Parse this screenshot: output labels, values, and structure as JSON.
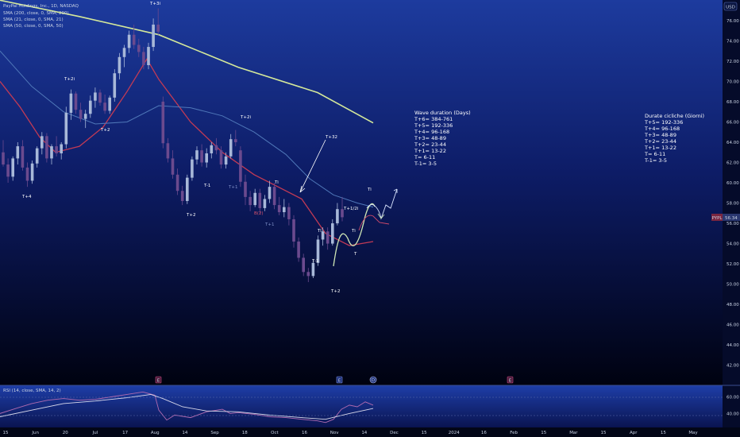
{
  "symbol_box": {
    "label": "USD"
  },
  "legend": [
    "PayPal Holdings, Inc., 1D, NASDAQ",
    "SMA (200, close, 0, SMA, 200)",
    "SMA (21, close, 0, SMA, 21)",
    "SMA (50, close, 0, SMA, 50)"
  ],
  "price_badge": {
    "ticker": "PYPL",
    "price": "56.34"
  },
  "rsi_legend": "RSI (14, close, SMA, 14, 2)",
  "notes": {
    "english": {
      "title": "Wave duration (Days)",
      "lines": [
        "T+6= 384-761",
        "T+5= 192-336",
        "T+4= 96-168",
        "T+3= 48-89",
        "T+2= 23-44",
        "T+1= 13-22",
        "T= 6-11",
        "T-1= 3-5"
      ]
    },
    "italian": {
      "title": "Durate cicliche (Giorni)",
      "lines": [
        "T+5= 192-336",
        "T+4= 96-168",
        "T+3= 48-89",
        "T+2= 23-44",
        "T+1= 13-22",
        "T= 6-11",
        "T-1= 3-5"
      ]
    }
  },
  "wave_labels": [
    {
      "text": "T+3i",
      "style": "white"
    },
    {
      "text": "T+2i",
      "style": "white"
    },
    {
      "text": "T+2",
      "style": "white"
    },
    {
      "text": "T+4",
      "style": "white"
    },
    {
      "text": "T+2",
      "style": "white"
    },
    {
      "text": "T-1",
      "style": "white"
    },
    {
      "text": "T+1",
      "style": "blue"
    },
    {
      "text": "T+2i",
      "style": "white"
    },
    {
      "text": "Ti",
      "style": "white"
    },
    {
      "text": "T+1",
      "style": "blue"
    },
    {
      "text": "B(2)",
      "style": "red"
    },
    {
      "text": "T+32",
      "style": "white"
    },
    {
      "text": "Ti",
      "style": "white"
    },
    {
      "text": "T-1",
      "style": "white"
    },
    {
      "text": "T+2",
      "style": "white"
    },
    {
      "text": "T+1/2i",
      "style": "white"
    },
    {
      "text": "Ti",
      "style": "white"
    },
    {
      "text": "T",
      "style": "white"
    },
    {
      "text": "Ti",
      "style": "white"
    }
  ],
  "event_markers": [
    "E",
    "E",
    "D",
    "E"
  ],
  "chart_data": [
    {
      "type": "line",
      "title": "PayPal Holdings, Inc., 1D, NASDAQ",
      "x_ticks": [
        "15",
        "Jun",
        "20",
        "Jul",
        "17",
        "Aug",
        "14",
        "Sep",
        "18",
        "Oct",
        "16",
        "Nov",
        "14",
        "Dec",
        "15",
        "2024",
        "16",
        "Feb",
        "15",
        "Mar",
        "15",
        "Apr",
        "15",
        "May"
      ],
      "y_ticks": [
        76.0,
        74.0,
        72.0,
        70.0,
        68.0,
        66.0,
        64.0,
        62.0,
        60.0,
        58.0,
        56.0,
        54.0,
        52.0,
        50.0,
        48.0,
        46.0,
        44.0,
        42.0
      ],
      "ylim": [
        40.8,
        77.4
      ],
      "candles": [
        [
          63.0,
          64.2,
          61.6,
          61.8
        ],
        [
          61.8,
          62.4,
          60.0,
          60.6
        ],
        [
          60.6,
          62.6,
          60.2,
          62.4
        ],
        [
          62.4,
          64.0,
          61.8,
          63.6
        ],
        [
          63.6,
          64.2,
          61.2,
          61.5
        ],
        [
          61.5,
          62.0,
          59.6,
          60.2
        ],
        [
          60.2,
          62.2,
          59.9,
          61.9
        ],
        [
          61.9,
          63.6,
          61.5,
          63.4
        ],
        [
          63.4,
          65.0,
          62.8,
          64.6
        ],
        [
          64.6,
          64.9,
          62.0,
          62.4
        ],
        [
          62.4,
          63.8,
          61.8,
          63.6
        ],
        [
          63.6,
          64.6,
          62.6,
          62.9
        ],
        [
          62.9,
          64.0,
          62.3,
          63.8
        ],
        [
          63.8,
          67.5,
          63.4,
          66.9
        ],
        [
          66.9,
          69.2,
          66.2,
          68.8
        ],
        [
          68.8,
          69.0,
          66.8,
          67.2
        ],
        [
          67.2,
          67.9,
          66.0,
          66.3
        ],
        [
          66.3,
          67.2,
          65.4,
          66.8
        ],
        [
          66.8,
          68.6,
          66.4,
          68.1
        ],
        [
          68.1,
          69.4,
          67.4,
          68.9
        ],
        [
          68.9,
          69.2,
          67.6,
          67.9
        ],
        [
          67.9,
          68.7,
          66.8,
          67.1
        ],
        [
          67.1,
          68.6,
          66.8,
          68.4
        ],
        [
          68.4,
          71.2,
          68.0,
          70.8
        ],
        [
          70.8,
          72.8,
          70.2,
          72.4
        ],
        [
          72.4,
          73.6,
          71.4,
          73.3
        ],
        [
          73.3,
          75.0,
          72.8,
          74.6
        ],
        [
          74.6,
          75.6,
          73.2,
          73.6
        ],
        [
          73.6,
          74.2,
          72.4,
          72.9
        ],
        [
          72.9,
          73.4,
          71.2,
          71.6
        ],
        [
          71.6,
          73.8,
          71.2,
          73.4
        ],
        [
          73.4,
          76.2,
          73.0,
          75.6
        ],
        [
          75.6,
          77.2,
          74.6,
          74.9
        ],
        [
          68.0,
          68.5,
          63.4,
          63.9
        ],
        [
          63.9,
          64.4,
          62.0,
          62.4
        ],
        [
          62.4,
          63.2,
          60.4,
          60.8
        ],
        [
          60.8,
          61.4,
          58.8,
          59.2
        ],
        [
          59.2,
          59.7,
          57.8,
          58.2
        ],
        [
          58.2,
          60.8,
          57.9,
          60.5
        ],
        [
          60.5,
          62.6,
          60.2,
          62.3
        ],
        [
          62.3,
          63.6,
          61.8,
          63.2
        ],
        [
          63.2,
          63.8,
          61.6,
          62.0
        ],
        [
          62.0,
          63.4,
          61.5,
          62.9
        ],
        [
          62.9,
          64.0,
          62.4,
          63.7
        ],
        [
          63.7,
          64.4,
          62.8,
          63.2
        ],
        [
          63.2,
          63.6,
          61.4,
          61.8
        ],
        [
          61.8,
          63.0,
          61.4,
          62.6
        ],
        [
          62.6,
          64.8,
          62.4,
          64.3
        ],
        [
          64.3,
          65.2,
          63.6,
          64.0
        ],
        [
          63.2,
          63.6,
          59.6,
          60.1
        ],
        [
          60.1,
          60.8,
          57.8,
          58.6
        ],
        [
          58.6,
          59.2,
          57.2,
          57.8
        ],
        [
          57.8,
          59.4,
          57.6,
          59.0
        ],
        [
          59.0,
          59.4,
          57.0,
          57.5
        ],
        [
          57.5,
          58.8,
          57.2,
          58.4
        ],
        [
          58.4,
          60.2,
          58.0,
          59.6
        ],
        [
          59.6,
          60.0,
          57.4,
          57.8
        ],
        [
          57.8,
          58.6,
          56.8,
          57.1
        ],
        [
          57.1,
          58.4,
          56.6,
          57.6
        ],
        [
          57.6,
          58.0,
          55.8,
          56.4
        ],
        [
          56.4,
          56.8,
          53.6,
          54.2
        ],
        [
          54.2,
          54.6,
          52.2,
          52.6
        ],
        [
          52.6,
          53.0,
          50.8,
          51.2
        ],
        [
          51.2,
          51.6,
          50.2,
          50.8
        ],
        [
          50.8,
          52.4,
          50.6,
          52.1
        ],
        [
          52.1,
          54.8,
          51.8,
          54.4
        ],
        [
          54.4,
          55.6,
          53.8,
          55.2
        ],
        [
          55.2,
          55.6,
          53.4,
          54.0
        ],
        [
          54.0,
          56.4,
          53.8,
          56.0
        ],
        [
          56.0,
          58.0,
          55.8,
          57.4
        ],
        [
          57.4,
          58.6,
          56.2,
          56.6
        ]
      ],
      "series": [
        {
          "name": "SMA (200, close, 0, SMA, 200)",
          "values": [
            [
              0,
              78.0
            ],
            [
              100,
              76.4
            ],
            [
              200,
              74.6
            ],
            [
              300,
              71.4
            ],
            [
              400,
              68.9
            ],
            [
              470,
              65.9
            ]
          ]
        },
        {
          "name": "SMA (21, close, 0, SMA, 21)",
          "values": [
            [
              0,
              70.0
            ],
            [
              25,
              67.5
            ],
            [
              50,
              64.5
            ],
            [
              70,
              63.0
            ],
            [
              100,
              63.6
            ],
            [
              130,
              65.5
            ],
            [
              160,
              69.0
            ],
            [
              185,
              72.2
            ],
            [
              200,
              70.2
            ],
            [
              240,
              66.0
            ],
            [
              280,
              63.0
            ],
            [
              320,
              60.8
            ],
            [
              350,
              59.6
            ],
            [
              380,
              58.4
            ],
            [
              410,
              55.0
            ],
            [
              440,
              53.8
            ],
            [
              470,
              54.2
            ]
          ]
        },
        {
          "name": "SMA (50, close, 0, SMA, 50)",
          "values": [
            [
              0,
              73.0
            ],
            [
              40,
              69.5
            ],
            [
              80,
              67.0
            ],
            [
              120,
              65.8
            ],
            [
              160,
              66.0
            ],
            [
              200,
              67.6
            ],
            [
              240,
              67.4
            ],
            [
              280,
              66.6
            ],
            [
              320,
              65.0
            ],
            [
              360,
              62.8
            ],
            [
              390,
              60.4
            ],
            [
              420,
              58.8
            ],
            [
              450,
              58.0
            ],
            [
              470,
              57.6
            ]
          ]
        }
      ]
    },
    {
      "type": "line",
      "title": "RSI (14, close, SMA, 14, 2)",
      "y_ticks": [
        60.0,
        40.0
      ],
      "ylim": [
        25,
        72
      ],
      "series": [
        {
          "name": "RSI",
          "values": [
            [
              0,
              40
            ],
            [
              20,
              46
            ],
            [
              40,
              52
            ],
            [
              60,
              56
            ],
            [
              80,
              58
            ],
            [
              100,
              56
            ],
            [
              120,
              57
            ],
            [
              140,
              60
            ],
            [
              160,
              63
            ],
            [
              180,
              66
            ],
            [
              195,
              62
            ],
            [
              200,
              44
            ],
            [
              210,
              32
            ],
            [
              220,
              38
            ],
            [
              240,
              35
            ],
            [
              260,
              42
            ],
            [
              280,
              45
            ],
            [
              290,
              40
            ],
            [
              300,
              41
            ],
            [
              320,
              39
            ],
            [
              340,
              36
            ],
            [
              360,
              35
            ],
            [
              380,
              33
            ],
            [
              400,
              31
            ],
            [
              410,
              29
            ],
            [
              420,
              33
            ],
            [
              430,
              45
            ],
            [
              440,
              50
            ],
            [
              450,
              48
            ],
            [
              460,
              54
            ],
            [
              470,
              50
            ]
          ]
        },
        {
          "name": "RSI SMA",
          "values": [
            [
              0,
              36
            ],
            [
              40,
              44
            ],
            [
              80,
              52
            ],
            [
              120,
              55
            ],
            [
              160,
              59
            ],
            [
              190,
              63
            ],
            [
              205,
              58
            ],
            [
              230,
              48
            ],
            [
              260,
              43
            ],
            [
              300,
              42
            ],
            [
              340,
              38
            ],
            [
              380,
              35
            ],
            [
              410,
              33
            ],
            [
              440,
              40
            ],
            [
              470,
              46
            ]
          ]
        }
      ]
    }
  ]
}
